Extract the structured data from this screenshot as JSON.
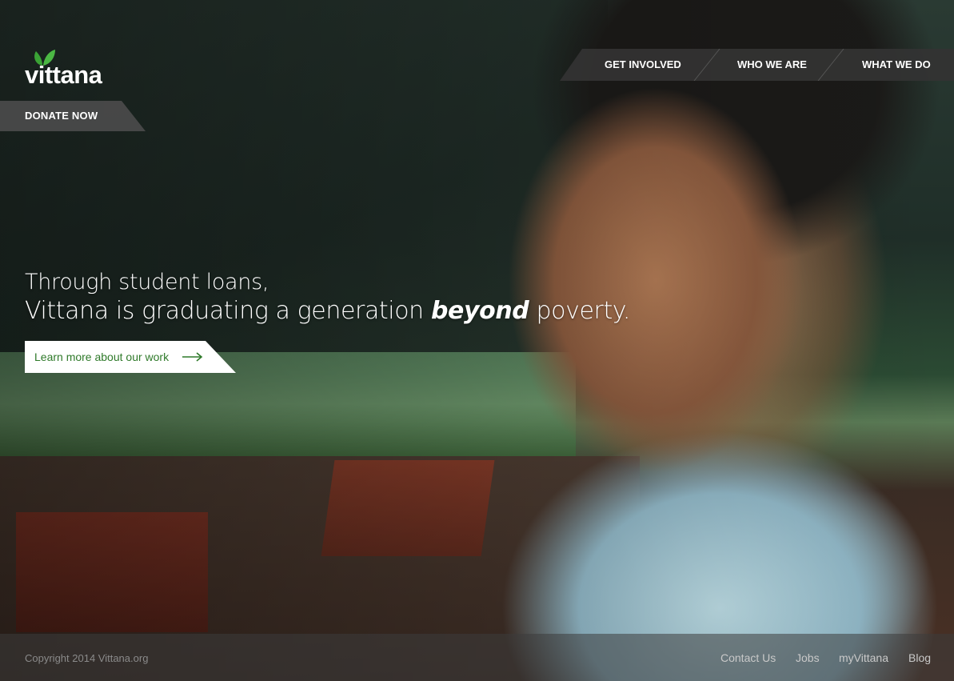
{
  "brand": {
    "name": "vittana",
    "leaf_color": "#3aa335",
    "accent_green": "#2f7a2a"
  },
  "donate": {
    "label": "DONATE NOW"
  },
  "nav": {
    "items": [
      {
        "label": "GET INVOLVED"
      },
      {
        "label": "WHO WE ARE"
      },
      {
        "label": "WHAT WE DO"
      }
    ]
  },
  "hero": {
    "line1": "Through student loans,",
    "line2_before": "Vittana is graduating a generation ",
    "line2_emphasis": "beyond",
    "line2_after": " poverty.",
    "cta_label": "Learn more about our work",
    "cta_icon": "arrow-right-icon"
  },
  "footer": {
    "copyright": "Copyright 2014 Vittana.org",
    "links": [
      {
        "label": "Contact Us"
      },
      {
        "label": "Jobs"
      },
      {
        "label": "myVittana"
      },
      {
        "label": "Blog"
      }
    ]
  }
}
